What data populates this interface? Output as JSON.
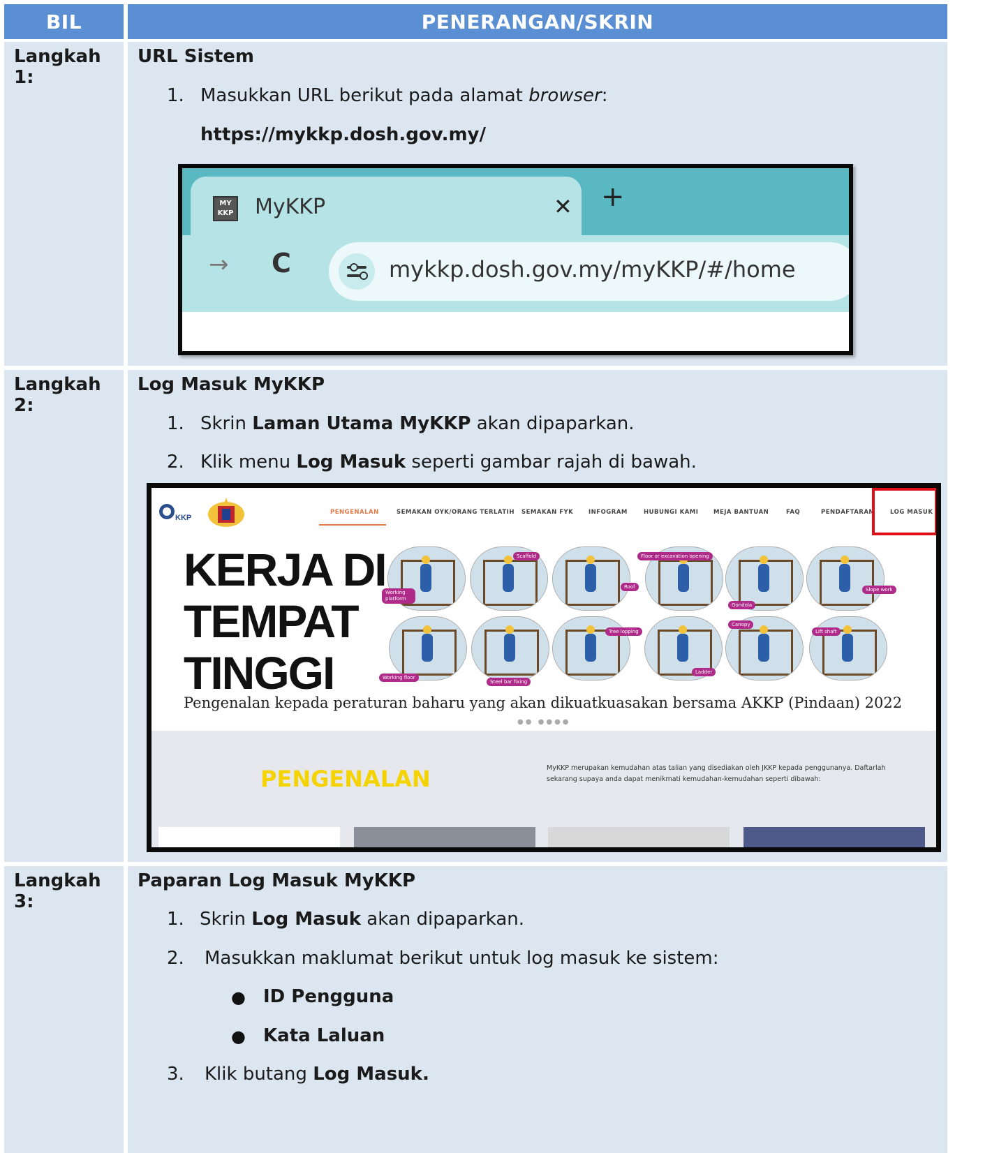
{
  "table": {
    "header_bil": "BIL",
    "header_desc": "PENERANGAN/SKRIN"
  },
  "step1": {
    "label": "Langkah 1:",
    "title": "URL Sistem",
    "item1_num": "1.",
    "item1_text_a": "Masukkan URL berikut pada alamat ",
    "item1_text_em": "browser",
    "item1_text_b": ":",
    "url": "https://mykkp.dosh.gov.my/"
  },
  "browser": {
    "tab_icon_text": "MY KKP",
    "tab_title": "MyKKP",
    "close_glyph": "✕",
    "new_tab_glyph": "+",
    "forward_glyph": "→",
    "reload_glyph": "C",
    "address": "mykkp.dosh.gov.my/myKKP/#/home"
  },
  "step2": {
    "label": "Langkah 2:",
    "title": "Log Masuk MyKKP",
    "item1_num": "1.",
    "item1_a": "Skrin ",
    "item1_b": "Laman Utama MyKKP",
    "item1_c": " akan dipaparkan.",
    "item2_num": "2.",
    "item2_a": "Klik menu ",
    "item2_b": "Log Masuk",
    "item2_c": " seperti gambar rajah di bawah."
  },
  "site": {
    "nav": [
      "PENGENALAN",
      "SEMAKAN OYK/ORANG TERLATIH",
      "SEMAKAN FYK",
      "INFOGRAM",
      "HUBUNGI KAMI",
      "MEJA BANTUAN",
      "FAQ",
      "PENDAFTARAN",
      "LOG MASUK"
    ],
    "hero_line1": "KERJA DI",
    "hero_line2": "TEMPAT",
    "hero_line3": "TINGGI",
    "tags": [
      "Working platform",
      "Scaffold",
      "Roof",
      "Floor or excavation opening",
      "Gondola",
      "Slope work",
      "Working floor",
      "Steel bar fixing",
      "Tree lopping",
      "Ladder",
      "Canopy",
      "Lift shaft"
    ],
    "caption": "Pengenalan kepada peraturan baharu yang akan dikuatkuasakan bersama AKKP (Pindaan) 2022",
    "intro_title": "PENGENALAN",
    "intro_text": "MyKKP merupakan kemudahan atas talian yang disediakan oleh JKKP kepada penggunanya. Daftarlah sekarang supaya anda dapat menikmati kemudahan-kemudahan seperti dibawah:"
  },
  "step3": {
    "label": "Langkah 3:",
    "title": "Paparan Log Masuk MyKKP",
    "item1_num": "1.",
    "item1_a": "Skrin ",
    "item1_b": "Log Masuk",
    "item1_c": " akan dipaparkan.",
    "item2_num": "2.",
    "item2_text": "Masukkan maklumat berikut untuk log masuk ke sistem:",
    "bullet1": "ID Pengguna",
    "bullet2": "Kata Laluan",
    "item3_num": "3.",
    "item3_a": "Klik butang ",
    "item3_b": "Log Masuk."
  },
  "colors": {
    "header_bg": "#5b8fd4",
    "cell_bg": "#dce6f1",
    "highlight": "#e0101a",
    "intro_title": "#f5d300"
  }
}
